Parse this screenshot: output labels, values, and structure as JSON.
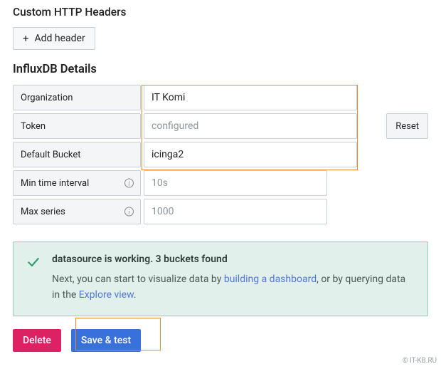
{
  "sections": {
    "custom_headers_title": "Custom HTTP Headers",
    "influx_title": "InfluxDB Details"
  },
  "add_header_label": "Add header",
  "fields": {
    "organization": {
      "label": "Organization",
      "value": "IT Komi"
    },
    "token": {
      "label": "Token",
      "placeholder": "configured"
    },
    "default_bucket": {
      "label": "Default Bucket",
      "value": "icinga2"
    },
    "min_interval": {
      "label": "Min time interval",
      "placeholder": "10s"
    },
    "max_series": {
      "label": "Max series",
      "placeholder": "1000"
    }
  },
  "reset_label": "Reset",
  "alert": {
    "title": "datasource is working. 3 buckets found",
    "body_1": "Next, you can start to visualize data by ",
    "link1": "building a dashboard",
    "body_2": ", or by querying data in the ",
    "link2": "Explore view",
    "body_3": "."
  },
  "actions": {
    "delete": "Delete",
    "save_test": "Save & test"
  },
  "watermark": "© IT-KB.RU"
}
